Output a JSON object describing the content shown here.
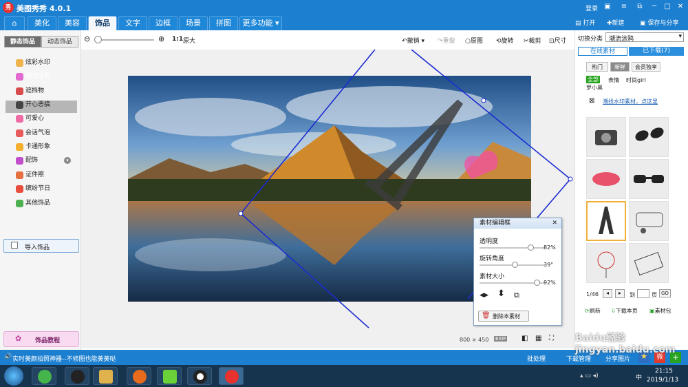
{
  "app": {
    "title": "美图秀秀 4.0.1",
    "login": "登录",
    "logo_char": "秀"
  },
  "nav": {
    "tabs": [
      "美化",
      "美容",
      "饰品",
      "文字",
      "边框",
      "场景",
      "拼图"
    ],
    "more": "更多功能",
    "active": "饰品",
    "open": "打开",
    "new": "新建",
    "save": "保存与分享"
  },
  "toolbar": {
    "zoom_ratio": "1:1",
    "original_size": "原大",
    "undo": "撤销",
    "redo": "重做",
    "original": "原图",
    "rotate": "旋转",
    "crop": "裁剪",
    "resize": "尺寸"
  },
  "left": {
    "tabs": [
      "静态饰品",
      "动态饰品"
    ],
    "items": [
      "炫彩水印",
      "潮流涂鸦",
      "遮挡物",
      "开心恶搞",
      "可爱心",
      "会话气泡",
      "卡通形象",
      "配饰",
      "证件照",
      "缤纷节日",
      "其他饰品"
    ],
    "selected": "潮流涂鸦",
    "import": "导入饰品",
    "tutorial": "饰品教程"
  },
  "right": {
    "category_label": "切换分类",
    "category_value": "潮流涂鸦",
    "tabs": [
      "在线素材",
      "已下载(7)"
    ],
    "chips": [
      "热门",
      "新鲜",
      "会员独享"
    ],
    "filters": [
      "全部",
      "表情",
      "时尚girl",
      "罗小黑"
    ],
    "watermark_link": "潮找水印素材，点这里",
    "page_indicator": "1/46",
    "goto_label": "到",
    "page_unit": "页",
    "go_button": "GO",
    "refresh": "刷新",
    "download_page": "下载本页",
    "pack": "素材包"
  },
  "dialog": {
    "title": "素材编辑框",
    "opacity_label": "透明度",
    "opacity_value": "82%",
    "opacity": 0.82,
    "rotation_label": "旋转角度",
    "rotation_value": "39°",
    "rotation": 39,
    "size_label": "素材大小",
    "size_value": "92%",
    "size": 0.92,
    "delete": "删除本素材"
  },
  "canvas": {
    "image_size": "800 × 450",
    "exif": "EXIF"
  },
  "status": {
    "tip": "实时美颜拍照神器--不修图也能美美哒",
    "batch": "批处理",
    "download_mgr": "下载管理",
    "share": "分享图片"
  },
  "taskbar": {
    "time": "21:15",
    "date": "2019/1/13",
    "lang": "中"
  },
  "watermark": "Baidu经验 jingyan.baidu.com"
}
